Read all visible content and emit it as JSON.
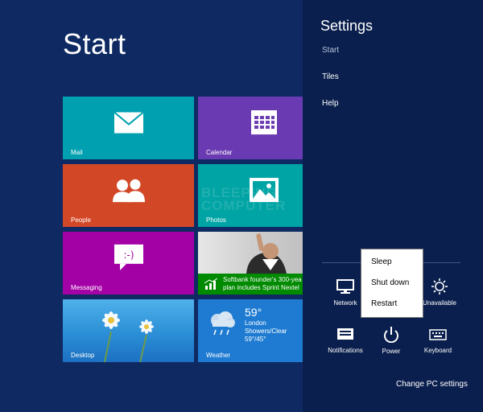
{
  "start": {
    "title": "Start"
  },
  "tiles": {
    "mail": {
      "label": "Mail",
      "color": "#00a0b0"
    },
    "calendar": {
      "label": "Calendar",
      "color": "#6a3ab2"
    },
    "people": {
      "label": "People",
      "color": "#d24726"
    },
    "photos": {
      "label": "Photos",
      "color": "#00a4a4"
    },
    "messaging": {
      "label": "Messaging",
      "color": "#a300a6"
    },
    "news": {
      "headline_line1": "Softbank founder's 300-yea",
      "headline_line2": "plan includes Sprint Nextel",
      "color": "#008a00"
    },
    "desktop": {
      "label": "Desktop",
      "color": "#2b8fd6"
    },
    "weather": {
      "label": "Weather",
      "temp": "59°",
      "city": "London",
      "condition": "Showers/Clear",
      "range": "59°/45°",
      "color": "#1e7bd1"
    }
  },
  "watermark": {
    "line1": "BLEEPING",
    "line2": "COMPUTER"
  },
  "settings": {
    "title": "Settings",
    "links": {
      "start": "Start",
      "tiles": "Tiles",
      "help": "Help"
    },
    "quick": {
      "network": "Network",
      "unavailable": "Unavailable",
      "notifications": "Notifications",
      "power": "Power",
      "keyboard": "Keyboard"
    },
    "change_pc": "Change PC settings"
  },
  "power_menu": {
    "sleep": "Sleep",
    "shutdown": "Shut down",
    "restart": "Restart"
  }
}
